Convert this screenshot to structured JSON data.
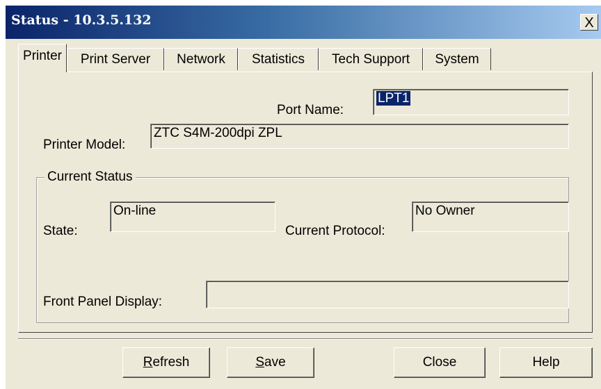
{
  "window": {
    "title": "Status - 10.3.5.132",
    "close_glyph": "X"
  },
  "tabs": [
    {
      "label": "Printer",
      "active": true
    },
    {
      "label": "Print Server",
      "active": false
    },
    {
      "label": "Network",
      "active": false
    },
    {
      "label": "Statistics",
      "active": false
    },
    {
      "label": "Tech Support",
      "active": false
    },
    {
      "label": "System",
      "active": false
    }
  ],
  "printer": {
    "port_name_label": "Port Name:",
    "port_name_value": "LPT1",
    "model_label": "Printer Model:",
    "model_value": "ZTC S4M-200dpi ZPL"
  },
  "current_status": {
    "title": "Current Status",
    "state_label": "State:",
    "state_value": "On-line",
    "protocol_label": "Current Protocol:",
    "protocol_value": "No Owner",
    "front_panel_label": "Front Panel Display:",
    "front_panel_value": ""
  },
  "buttons": {
    "refresh_first": "R",
    "refresh_rest": "efresh",
    "save_first": "S",
    "save_rest": "ave",
    "close": "Close",
    "help": "Help"
  },
  "colors": {
    "titlebar_start": "#0a246a",
    "titlebar_end": "#a6caf0",
    "face": "#ece9d8"
  }
}
